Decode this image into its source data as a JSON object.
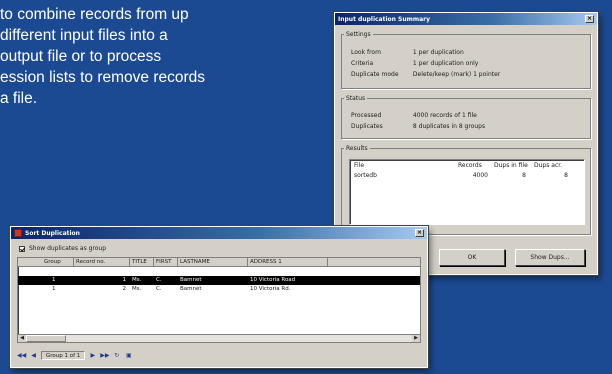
{
  "blurb": {
    "lines": [
      "to combine records from up",
      "different input files into a",
      "output file or to process",
      "ession lists to remove records",
      "a file."
    ]
  },
  "summary_window": {
    "title": "Input duplication Summary",
    "close": "×",
    "settings": {
      "legend": "Settings",
      "rows": [
        {
          "key": "Look from",
          "value": "1 per duplication"
        },
        {
          "key": "Criteria",
          "value": "1 per duplication only"
        },
        {
          "key": "Duplicate mode",
          "value": "Delete/keep (mark) 1 pointer"
        }
      ]
    },
    "status": {
      "legend": "Status",
      "rows": [
        {
          "key": "Processed",
          "value": "4000 records of 1 file"
        },
        {
          "key": "Duplicates",
          "value": "8 duplicates in 8 groups"
        }
      ]
    },
    "results": {
      "legend": "Results",
      "columns": [
        "File",
        "Records",
        "Dups in file",
        "Dups acr."
      ],
      "rows": [
        {
          "file": "sortedb",
          "records": "4000",
          "dups_in": "8",
          "dups_across": "8"
        }
      ]
    },
    "buttons": {
      "ok": "OK",
      "show_dups": "Show Dups..."
    }
  },
  "dup_window": {
    "title": "Sort Duplication",
    "close": "×",
    "checkbox_label": "Show duplicates as group",
    "columns": [
      "Group",
      "Record no.",
      "TITLE",
      "FIRST",
      "LASTNAME",
      "ADDRESS 1"
    ],
    "rows": [
      {
        "group": "",
        "record": "",
        "title": "",
        "first": "",
        "last": "",
        "addr": "",
        "selected": false
      },
      {
        "group": "1",
        "record": "1",
        "title": "Ms.",
        "first": "C.",
        "last": "Bamnet",
        "addr": "10 Victoria Road",
        "selected": true
      },
      {
        "group": "1",
        "record": "2",
        "title": "Ms.",
        "first": "C.",
        "last": "Bamnet",
        "addr": "10 Victoria Rd.",
        "selected": false
      }
    ],
    "pager": {
      "label": "Group 1 of 1"
    }
  },
  "colors": {
    "background": "#1c4a92",
    "window_face": "#d4d0c8",
    "title_bar": "#0a246a"
  }
}
